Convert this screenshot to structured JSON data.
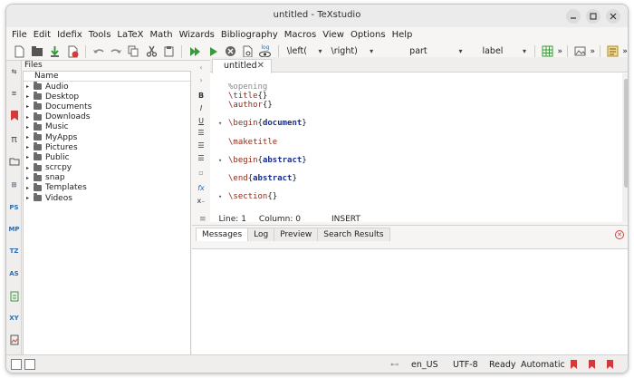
{
  "window": {
    "title": "untitled - TeXstudio"
  },
  "menu": [
    "File",
    "Edit",
    "Idefix",
    "Tools",
    "LaTeX",
    "Math",
    "Wizards",
    "Bibliography",
    "Macros",
    "View",
    "Options",
    "Help"
  ],
  "toolbar": {
    "combos": [
      "\\left(",
      "\\right)",
      "part",
      "label"
    ],
    "more": "»",
    "log_label": "log"
  },
  "sidebar_strip": [
    "PS",
    "MP",
    "TZ",
    "AS",
    "XY"
  ],
  "files_panel": {
    "title": "Files",
    "column_header": "Name",
    "items": [
      "Audio",
      "Desktop",
      "Documents",
      "Downloads",
      "Music",
      "MyApps",
      "Pictures",
      "Public",
      "scrcpy",
      "snap",
      "Templates",
      "Videos"
    ]
  },
  "editor": {
    "tab_label": "untitled",
    "lines": {
      "l1": "%opening",
      "l2_cmd": "\\title",
      "l2_args": "{}",
      "l3_cmd": "\\author",
      "l3_args": "{}",
      "l4_cmd": "\\begin",
      "l4_arg": "document",
      "l5_cmd": "\\maketitle",
      "l6_cmd": "\\begin",
      "l6_arg": "abstract",
      "l7_cmd": "\\end",
      "l7_arg": "abstract",
      "l8_cmd": "\\section",
      "l8_args": "{}"
    }
  },
  "status_line": {
    "line": "Line: 1",
    "column": "Column: 0",
    "mode": "INSERT"
  },
  "messages": {
    "tabs": [
      "Messages",
      "Log",
      "Preview",
      "Search Results"
    ]
  },
  "statusbar": {
    "language": "en_US",
    "encoding": "UTF-8",
    "state": "Ready",
    "spell": "Automatic"
  },
  "colors": {
    "keyword": "#8b2d1a",
    "argument": "#1a2f8b",
    "comment": "#8a8a8a",
    "bookmark": "#d33b3b"
  }
}
